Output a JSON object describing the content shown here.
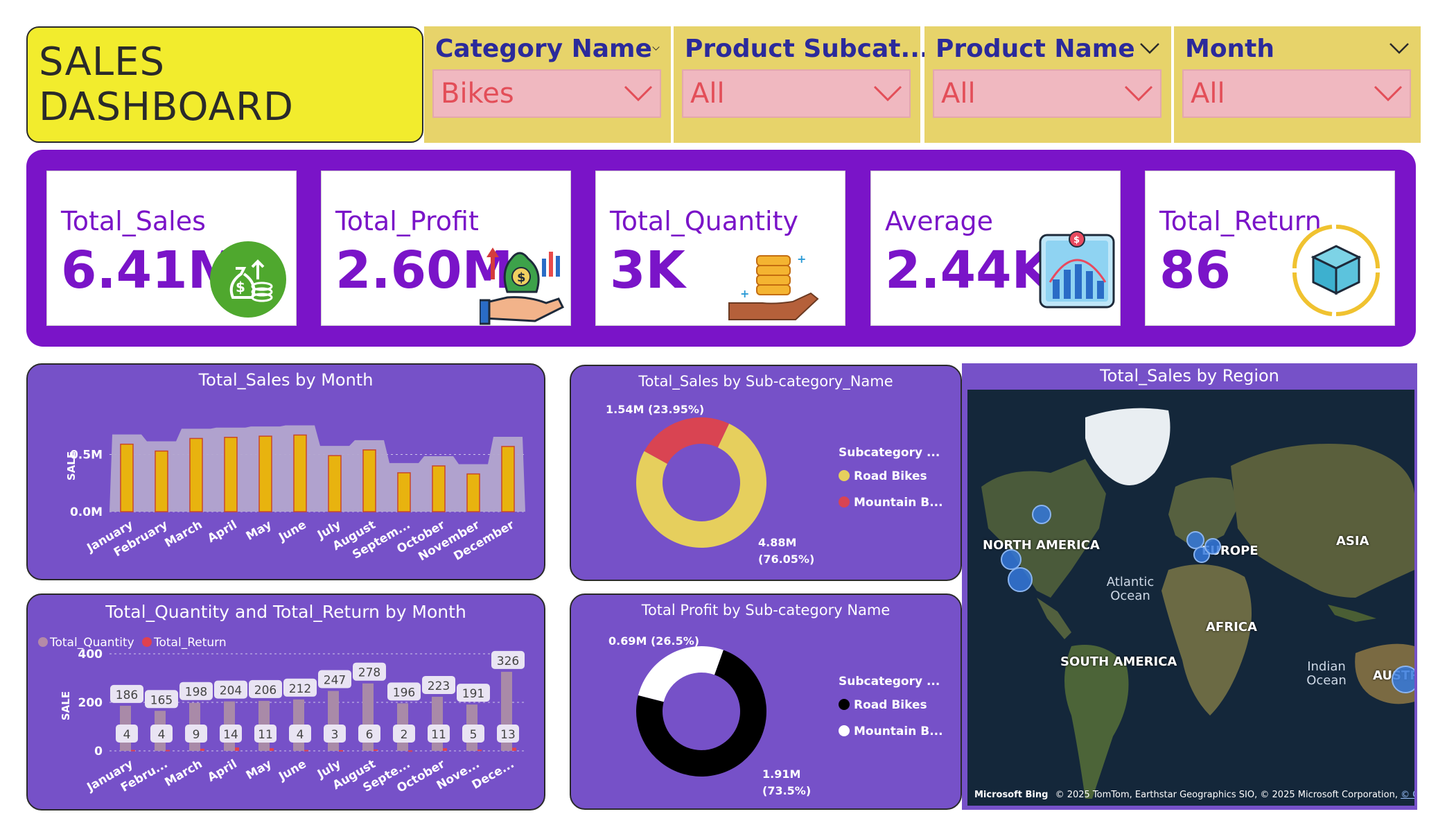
{
  "title": "SALES DASHBOARD",
  "slicers": [
    {
      "label": "Category Name",
      "value": "Bikes"
    },
    {
      "label": "Product Subcat...",
      "value": "All"
    },
    {
      "label": "Product Name",
      "value": "All"
    },
    {
      "label": "Month",
      "value": "All"
    }
  ],
  "kpis": [
    {
      "title": "Total_Sales",
      "value": "6.41M",
      "icon": "money-bag-icon"
    },
    {
      "title": "Total_Profit",
      "value": "2.60M",
      "icon": "profit-hand-icon"
    },
    {
      "title": "Total_Quantity",
      "value": "3K",
      "icon": "coins-hand-icon"
    },
    {
      "title": "Average",
      "value": "2.44K",
      "icon": "bar-chart-icon"
    },
    {
      "title": "Total_Return",
      "value": "86",
      "icon": "return-box-icon"
    }
  ],
  "colors": {
    "kpi_purple": "#7a14c8",
    "panel_purple": "#7651c8",
    "slicer_bg": "#e7d36a",
    "title_yellow": "#f2ec2d",
    "bar_gold": "#e8b30f",
    "area_fill": "#b3a6cf",
    "donut_yellow": "#e6cf5d",
    "donut_red": "#d94452"
  },
  "chart_data": [
    {
      "type": "bar",
      "title": "Total_Sales by Month",
      "ylabel": "SALE",
      "categories": [
        "January",
        "February",
        "March",
        "April",
        "May",
        "June",
        "July",
        "August",
        "Septem...",
        "October",
        "November",
        "December"
      ],
      "values": [
        0.59,
        0.53,
        0.64,
        0.65,
        0.66,
        0.67,
        0.49,
        0.54,
        0.34,
        0.4,
        0.33,
        0.57
      ],
      "yticks": [
        "0.0M",
        "0.5M"
      ],
      "ylim": [
        0,
        0.8
      ]
    },
    {
      "type": "bar",
      "title": "Total_Quantity and Total_Return by Month",
      "ylabel": "SALE",
      "legend": [
        "Total_Quantity",
        "Total_Return"
      ],
      "categories": [
        "January",
        "Febru...",
        "March",
        "April",
        "May",
        "June",
        "July",
        "August",
        "Septe...",
        "October",
        "Nove...",
        "Dece..."
      ],
      "series": [
        {
          "name": "Total_Quantity",
          "values": [
            186,
            165,
            198,
            204,
            206,
            212,
            247,
            278,
            196,
            223,
            191,
            326
          ]
        },
        {
          "name": "Total_Return",
          "values": [
            4,
            4,
            9,
            14,
            11,
            4,
            3,
            6,
            2,
            11,
            5,
            13
          ]
        }
      ],
      "yticks": [
        "0",
        "200",
        "400"
      ],
      "ylim": [
        0,
        450
      ]
    },
    {
      "type": "pie",
      "title": "Total_Sales by Sub-category_Name",
      "legend_title": "Subcategory ...",
      "categories": [
        "Road Bikes",
        "Mountain B..."
      ],
      "values": [
        4.88,
        1.54
      ],
      "labels": [
        "4.88M (76.05%)",
        "1.54M (23.95%)"
      ],
      "label_lines": [
        [
          "4.88M",
          "(76.05%)"
        ],
        [
          "1.54M (23.95%)"
        ]
      ]
    },
    {
      "type": "pie",
      "title": "Total Profit by Sub-category Name",
      "legend_title": "Subcategory ...",
      "categories": [
        "Road Bikes",
        "Mountain B..."
      ],
      "values": [
        1.91,
        0.69
      ],
      "labels": [
        "1.91M (73.5%)",
        "0.69M (26.5%)"
      ],
      "label_lines": [
        [
          "1.91M",
          "(73.5%)"
        ],
        [
          "0.69M (26.5%)"
        ]
      ]
    }
  ],
  "map": {
    "title": "Total_Sales by Region",
    "regions": [
      "NORTH AMERICA",
      "EUROPE",
      "ASIA",
      "AFRICA",
      "SOUTH AMERICA",
      "AUSTR"
    ],
    "oceans": [
      "Atlantic Ocean",
      "Indian Ocean"
    ],
    "attribution": "© 2025 TomTom, Earthstar Geographics SIO, © 2025 Microsoft Corporation,",
    "attribution_link": "© OpenStreetMap",
    "logo": "Microsoft Bing"
  }
}
